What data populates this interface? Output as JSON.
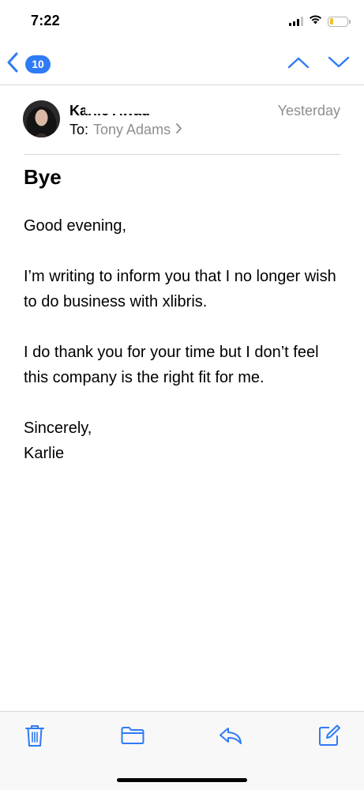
{
  "status_bar": {
    "time": "7:22",
    "battery_level": 0.22,
    "battery_color": "#f2c12e"
  },
  "nav": {
    "unread_count": "10",
    "accent_color": "#2f7bf6",
    "icons": [
      "chevron-left-icon",
      "chevron-up-icon",
      "chevron-down-icon"
    ]
  },
  "header": {
    "sender_name": "Karlie Awad",
    "to_label": "To:",
    "recipient": "Tony Adams",
    "date": "Yesterday"
  },
  "message": {
    "subject": "Bye",
    "paragraphs": [
      "Good evening,",
      "I’m writing to inform you that I no longer wish to do business with xlibris.",
      "I do thank you for your time but I don’t feel this company is the right fit for me.",
      "Sincerely,",
      "Karlie"
    ]
  },
  "toolbar": {
    "icons": [
      "trash-icon",
      "folder-icon",
      "reply-icon",
      "compose-icon"
    ]
  }
}
